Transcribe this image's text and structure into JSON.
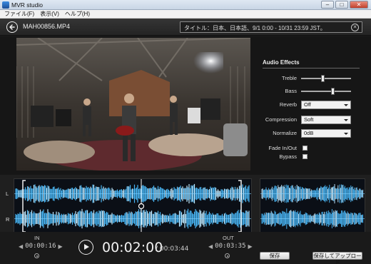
{
  "window": {
    "title": "MVR studio",
    "minimize": "–",
    "maximize": "□",
    "close": "✕"
  },
  "menu": [
    "ファイル(F)",
    "表示(V)",
    "ヘルプ(H)"
  ],
  "header": {
    "filename": "MAH00856.MP4",
    "filter_text": "タイトル：日本、日本語、9/1 0:00 - 10/31 23:59 JST。",
    "clear_glyph": "✕"
  },
  "effects": {
    "title": "Audio Effects",
    "treble": {
      "label": "Treble",
      "value": 0.45
    },
    "bass": {
      "label": "Bass",
      "value": 0.65
    },
    "reverb": {
      "label": "Reverb",
      "value": "Off"
    },
    "compression": {
      "label": "Compression",
      "value": "Soft"
    },
    "normalize": {
      "label": "Normalize",
      "value": "0dB"
    },
    "fade": {
      "label": "Fade In/Out",
      "checked": false
    },
    "bypass": {
      "label": "Bypass",
      "checked": false
    }
  },
  "waveform": {
    "left_label": "L",
    "right_label": "R"
  },
  "transport": {
    "in_label": "IN",
    "in_time": "00:00:16",
    "out_label": "OUT",
    "out_time": "00:03:35",
    "current_time": "00:02:00",
    "total_time": "/ 00:03:44",
    "prev_arrow": "◀",
    "next_arrow": "▶"
  },
  "buttons": {
    "save": "保存",
    "save_upload": "保存してアップロード"
  },
  "colors": {
    "wave": "#49b6f5",
    "wave_light": "#bfe8ff",
    "background": "#1b1b1b"
  }
}
